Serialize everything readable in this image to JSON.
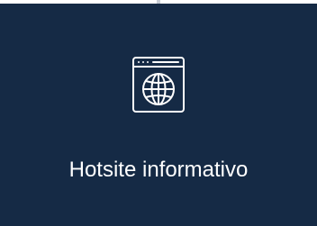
{
  "card": {
    "title": "Hotsite informativo",
    "icon": "browser-globe-icon",
    "background_color": "#152a45",
    "text_color": "#ffffff"
  }
}
